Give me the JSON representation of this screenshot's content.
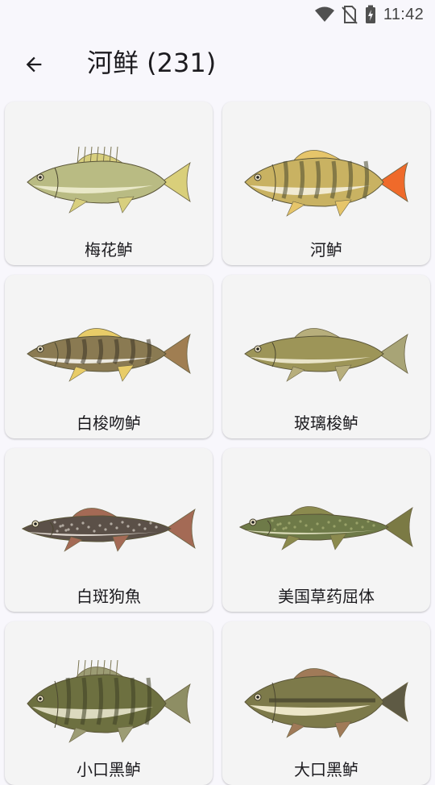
{
  "status_bar": {
    "time": "11:42",
    "icons": [
      "wifi-icon",
      "no-sim-icon",
      "battery-charging-icon"
    ]
  },
  "app_bar": {
    "back_icon": "arrow-back-icon",
    "title": "河鲜 (231)"
  },
  "fish_list": [
    {
      "name": "梅花鲈",
      "colors": {
        "body": "#b9bb83",
        "belly": "#e9e8c8",
        "fin": "#d8cf7e",
        "tail": "#d9cf7a",
        "mark": "#7d8a4e"
      }
    },
    {
      "name": "河鲈",
      "colors": {
        "body": "#c9b262",
        "belly": "#f1ead2",
        "fin": "#e6c56a",
        "tail": "#ef6a2a",
        "mark": "#4a4a30"
      }
    },
    {
      "name": "白梭吻鲈",
      "colors": {
        "body": "#8a7a52",
        "belly": "#ece9e0",
        "fin": "#e8cc68",
        "tail": "#a07e52",
        "mark": "#3c3426"
      }
    },
    {
      "name": "玻璃梭鲈",
      "colors": {
        "body": "#9d9558",
        "belly": "#e9e4c8",
        "fin": "#b7ae7c",
        "tail": "#a8a476",
        "mark": "#6e6838"
      }
    },
    {
      "name": "白斑狗魚",
      "colors": {
        "body": "#5b5048",
        "belly": "#e0d8d0",
        "fin": "#a46a55",
        "tail": "#a46a55",
        "mark": "#c8c0b8"
      }
    },
    {
      "name": "美国草药屈体",
      "colors": {
        "body": "#6e7a48",
        "belly": "#d7d8b6",
        "fin": "#8b8a4e",
        "tail": "#7b7a44",
        "mark": "#a4ac72"
      }
    },
    {
      "name": "小口黑鲈",
      "colors": {
        "body": "#6d7040",
        "belly": "#dcdabf",
        "fin": "#9c9c74",
        "tail": "#8e8e64",
        "mark": "#3e4024"
      }
    },
    {
      "name": "大口黑鲈",
      "colors": {
        "body": "#7d7a4a",
        "belly": "#ece6c8",
        "fin": "#a07a58",
        "tail": "#5e5a44",
        "mark": "#3a3626"
      }
    }
  ]
}
